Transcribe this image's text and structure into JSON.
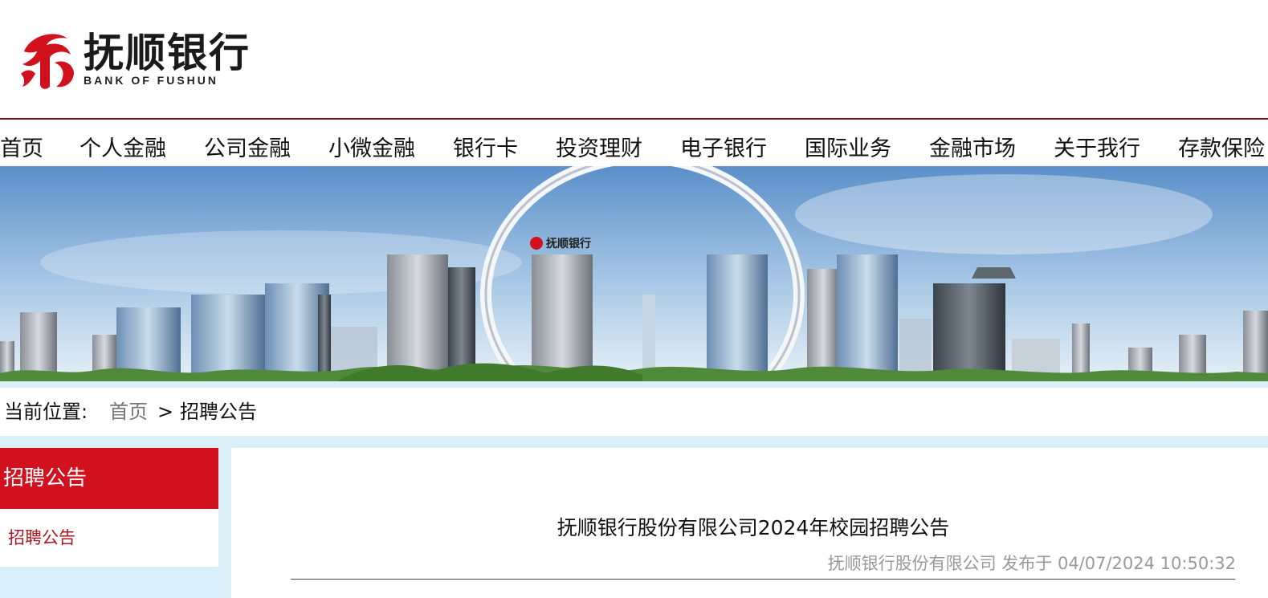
{
  "logo": {
    "name_cn": "抚顺银行",
    "name_en": "BANK OF  FUSHUN"
  },
  "nav": {
    "items": [
      "首页",
      "个人金融",
      "公司金融",
      "小微金融",
      "银行卡",
      "投资理财",
      "电子银行",
      "国际业务",
      "金融市场",
      "关于我行",
      "存款保险"
    ]
  },
  "banner": {
    "alt_logo": "抚顺银行"
  },
  "breadcrumb": {
    "label": "当前位置:",
    "home": "首页",
    "separator": ">",
    "current": "招聘公告"
  },
  "sidebar": {
    "title": "招聘公告",
    "items": [
      "招聘公告"
    ]
  },
  "article": {
    "title": "抚顺银行股份有限公司2024年校园招聘公告",
    "meta": "抚顺银行股份有限公司 发布于 04/07/2024 10:50:32"
  },
  "colors": {
    "brand_red": "#d2111f",
    "header_line": "#7b1418",
    "page_bg": "#dbeffb"
  }
}
